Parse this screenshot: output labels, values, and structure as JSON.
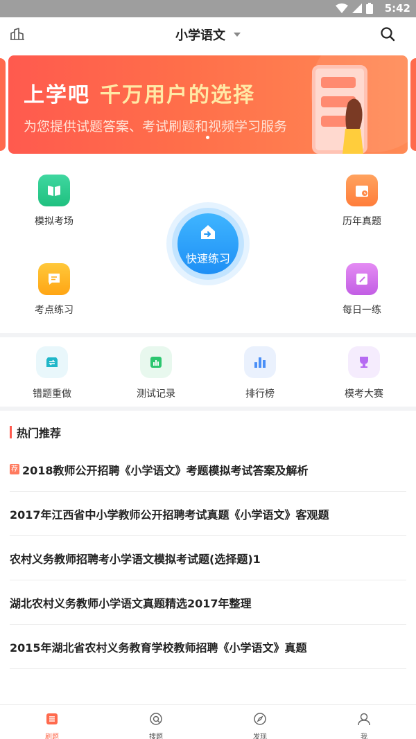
{
  "status_bar": {
    "time": "5:42"
  },
  "header": {
    "title": "小学语文"
  },
  "banner": {
    "title": "上学吧",
    "highlight": "千万用户的选择",
    "subtitle": "为您提供试题答案、考试刷题和视频学习服务"
  },
  "modules": {
    "mock_exam": "模拟考场",
    "past_papers": "历年真题",
    "point_practice": "考点练习",
    "daily_practice": "每日一练",
    "quick_practice": "快速练习"
  },
  "tools": [
    {
      "label": "错题重做",
      "icon": "redo-icon",
      "color": "#1fb6c8"
    },
    {
      "label": "测试记录",
      "icon": "chart-icon",
      "color": "#2cc66f"
    },
    {
      "label": "排行榜",
      "icon": "ranking-icon",
      "color": "#4a8ff7"
    },
    {
      "label": "模考大赛",
      "icon": "trophy-icon",
      "color": "#b66bf2"
    }
  ],
  "hot": {
    "title": "热门推荐",
    "tag": "荐",
    "items": [
      "2018教师公开招聘《小学语文》考题模拟考试答案及解析",
      "2017年江西省中小学教师公开招聘考试真题《小学语文》客观题",
      "农村义务教师招聘考小学语文模拟考试题(选择题)1",
      "湖北农村义务教师小学语文真题精选2017年整理",
      "2015年湖北省农村义务教育学校教师招聘《小学语文》真题"
    ]
  },
  "tabbar": {
    "tabs": [
      {
        "label": "刷题",
        "icon": "list-icon"
      },
      {
        "label": "搜题",
        "icon": "search-question-icon"
      },
      {
        "label": "发现",
        "icon": "compass-icon"
      },
      {
        "label": "我",
        "icon": "user-icon"
      }
    ]
  },
  "colors": {
    "accent": "#ff6a4d",
    "quick": "#1e8ff5"
  }
}
